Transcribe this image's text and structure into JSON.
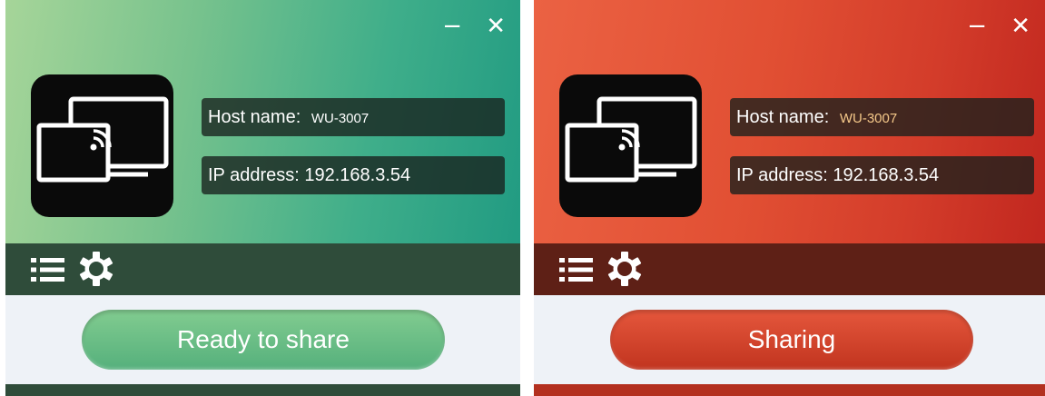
{
  "colors": {
    "ready_accent": "#55b07c",
    "sharing_accent": "#c1341f",
    "host_value_sharing": "#f5c889"
  },
  "ready_window": {
    "minimize_glyph": "−",
    "close_glyph": "✕",
    "app_icon": "screen-cast-icon",
    "host_label": "Host name:",
    "host_value": "WU-3007",
    "ip_text": "IP address: 192.168.3.54",
    "menu_icon": "list-icon",
    "settings_icon": "gear-icon",
    "button_label": "Ready to share"
  },
  "sharing_window": {
    "minimize_glyph": "−",
    "close_glyph": "✕",
    "app_icon": "screen-cast-icon",
    "host_label": "Host name:",
    "host_value": "WU-3007",
    "ip_text": "IP address: 192.168.3.54",
    "menu_icon": "list-icon",
    "settings_icon": "gear-icon",
    "button_label": "Sharing"
  }
}
